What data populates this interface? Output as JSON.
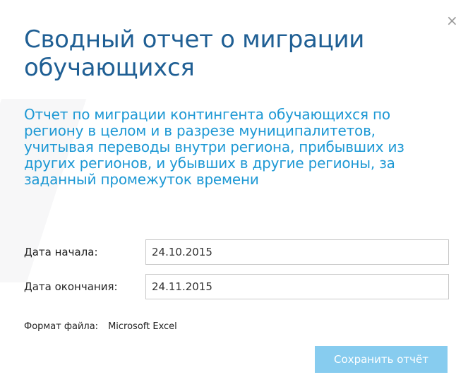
{
  "dialog": {
    "title": "Сводный отчет о миграции обучающихся",
    "description": "Отчет по миграции контингента обучающихся по региону в целом и в разрезе муниципалитетов, учитывая переводы внутри региона, прибывших из других регионов, и убывших в другие регионы, за заданный промежуток времени",
    "close_icon": "×"
  },
  "form": {
    "start_label": "Дата начала:",
    "start_value": "24.10.2015",
    "end_label": "Дата окончания:",
    "end_value": "24.11.2015",
    "format_label": "Формат файла:",
    "format_value": "Microsoft Excel"
  },
  "actions": {
    "save_label": "Сохранить отчёт"
  },
  "colors": {
    "title": "#1f5f94",
    "description": "#1d98d4",
    "button": "#87ccef"
  }
}
